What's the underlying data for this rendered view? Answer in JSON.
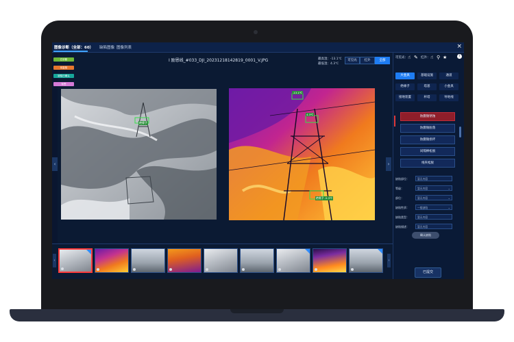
{
  "header": {
    "tabs": [
      {
        "label": "图像诊断（全部：60）",
        "active": true
      },
      {
        "label": "缺陷图像",
        "active": false
      },
      {
        "label": "图像列表",
        "active": false
      }
    ],
    "close_icon": "close-icon"
  },
  "tags": [
    {
      "label": "已诊断",
      "color": "#6fb83a"
    },
    {
      "label": "待复核",
      "color": "#e8772e"
    },
    {
      "label": "缺陷已确认",
      "color": "#17a79a"
    },
    {
      "label": "标签",
      "color": "#d57ad6"
    }
  ],
  "image": {
    "filename": "I 励恩线_#033_DJI_20231218142819_0001_V.JPG",
    "max_temp": "最高温：-13.1℃",
    "min_temp": "最低温：4.3℃",
    "view_modes": [
      {
        "label": "可见光",
        "active": false
      },
      {
        "label": "红外",
        "active": false
      },
      {
        "label": "全部",
        "active": true
      }
    ],
    "visible_box_label": "绝缘子",
    "thermal_labels": [
      "-13.1℃",
      "4.3℃",
      "绝缘子 -5.3℃"
    ]
  },
  "right_panel": {
    "toggle_labels": [
      "可见光：",
      "红外："
    ],
    "categories": [
      {
        "label": "大金具",
        "active": true
      },
      {
        "label": "基础设施",
        "active": false
      },
      {
        "label": "通道",
        "active": false
      },
      {
        "label": "绝缘子",
        "active": false
      },
      {
        "label": "塔基",
        "active": false
      },
      {
        "label": "小金具",
        "active": false
      },
      {
        "label": "接地装置",
        "active": false
      },
      {
        "label": "杆塔",
        "active": false
      },
      {
        "label": "导地线",
        "active": false
      }
    ],
    "defects": [
      {
        "label": "防震锤锈蚀",
        "active": true
      },
      {
        "label": "防震锤脱落",
        "active": false
      },
      {
        "label": "防震锤损坏",
        "active": false
      },
      {
        "label": "间隔棒松脱",
        "active": false
      },
      {
        "label": "线夹松脱",
        "active": false
      }
    ],
    "form": {
      "fields": [
        {
          "label": "缺陷部位：",
          "value": "暂无内容",
          "dropdown": false
        },
        {
          "label": "等级：",
          "value": "暂无内容",
          "dropdown": true
        },
        {
          "label": "部位：",
          "value": "暂无内容",
          "dropdown": true
        },
        {
          "label": "缺陷性质：",
          "value": "一般缺陷",
          "dropdown": true
        },
        {
          "label": "缺陷类型：",
          "value": "暂无内容",
          "dropdown": false
        },
        {
          "label": "缺陷描述：",
          "value": "暂无内容",
          "dropdown": false
        }
      ],
      "confirm_label": "确认缺陷"
    },
    "submit_label": "已提交"
  },
  "thumbnails": [
    {
      "style": "t-snow",
      "selected": true,
      "checked": true
    },
    {
      "style": "t-heat",
      "selected": false,
      "checked": false
    },
    {
      "style": "t-sky",
      "selected": false,
      "checked": false
    },
    {
      "style": "t-heat2",
      "selected": false,
      "checked": false
    },
    {
      "style": "t-snow",
      "selected": false,
      "checked": false
    },
    {
      "style": "t-sky",
      "selected": false,
      "checked": false
    },
    {
      "style": "t-snow",
      "selected": false,
      "checked": true
    },
    {
      "style": "t-heat3",
      "selected": false,
      "checked": false
    },
    {
      "style": "t-sky",
      "selected": false,
      "checked": true
    }
  ]
}
